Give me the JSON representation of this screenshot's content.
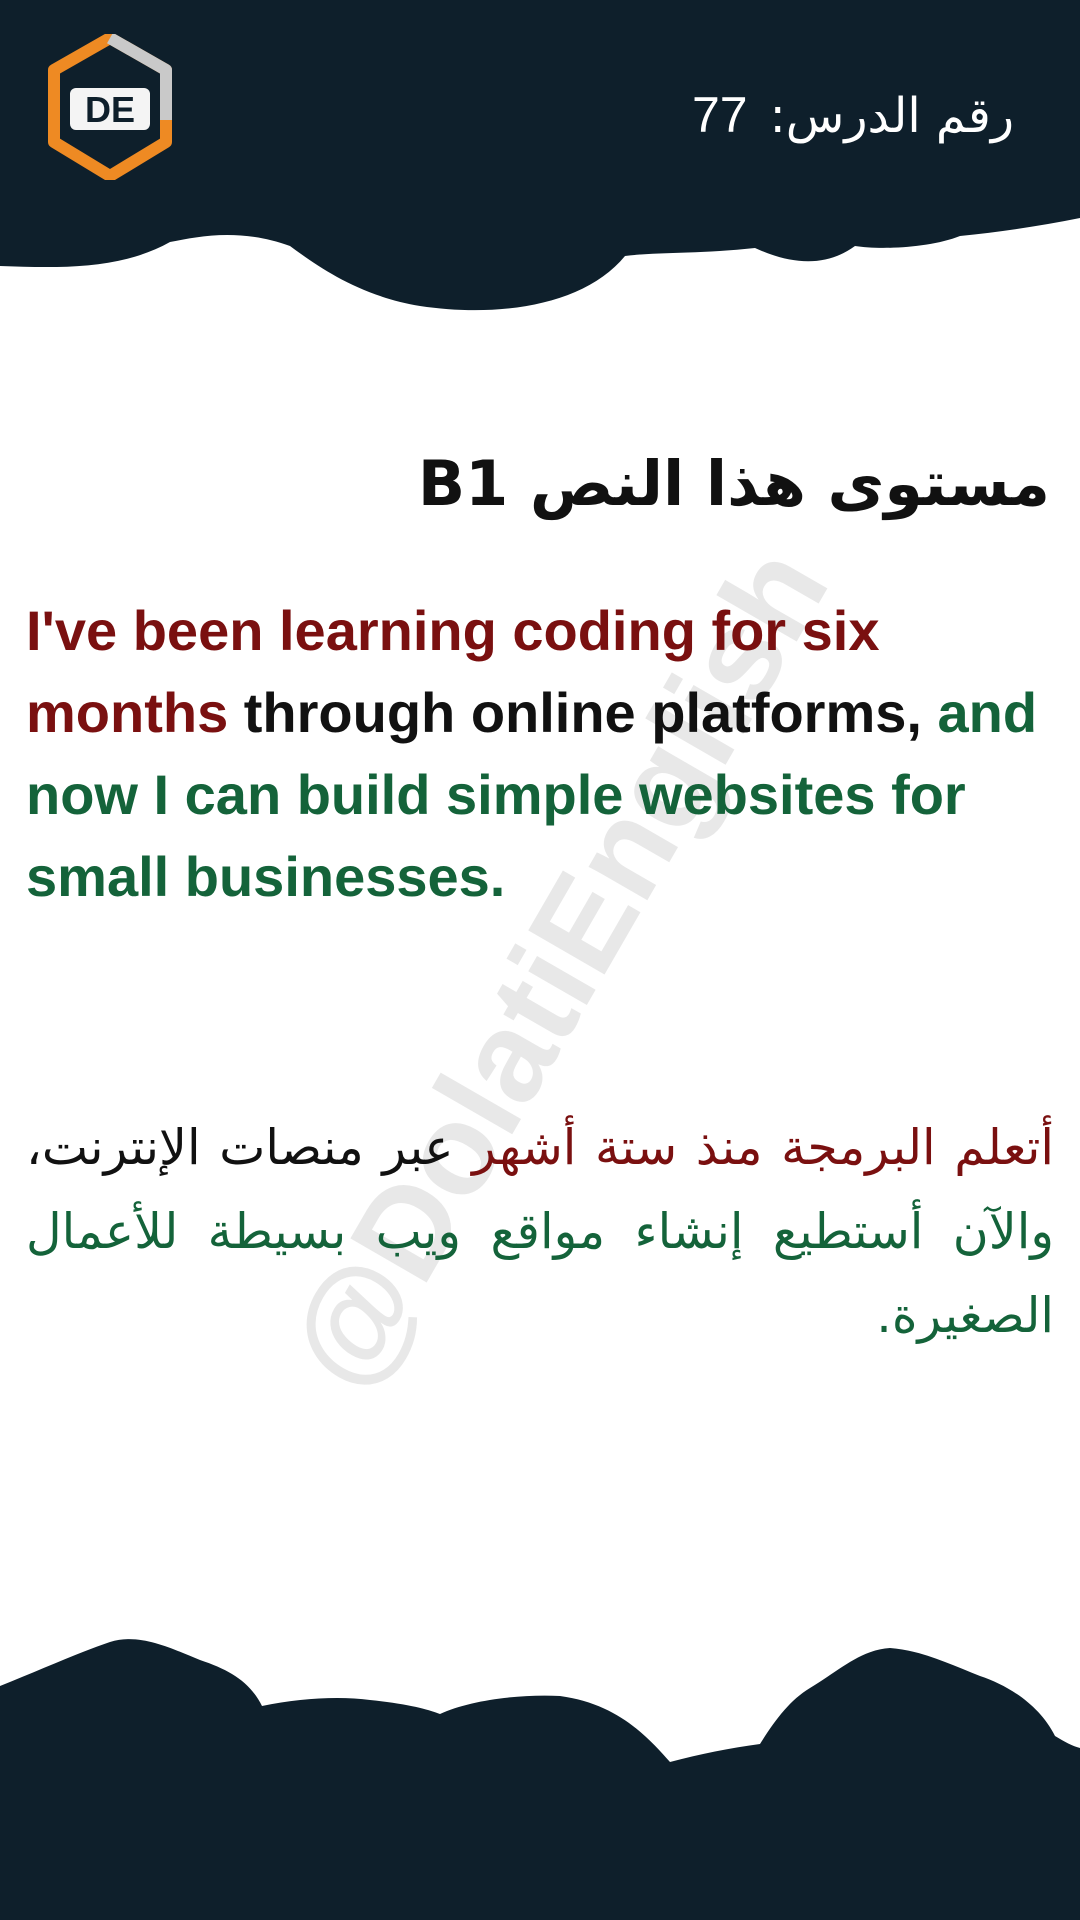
{
  "header": {
    "lesson_label": "رقم الدرس:",
    "lesson_number": "77",
    "logo_text": "DE"
  },
  "level": {
    "title": "مستوى هذا النص B1"
  },
  "english": {
    "segment_red": "I've been learning coding for six months",
    "segment_dark": " through online platforms,",
    "segment_green": " and now I can build simple websites for small businesses."
  },
  "arabic": {
    "segment_red": "أتعلم البرمجة منذ ستة أشهر",
    "segment_dark": " عبر منصات الإنترنت،",
    "segment_green": " والآن أستطيع إنشاء مواقع ويب بسيطة للأعمال الصغيرة."
  },
  "watermark": {
    "text": "@DolatiEnglish"
  },
  "colors": {
    "background": "#ffffff",
    "banner": "#0e1f2b",
    "accent_orange": "#ee8a23",
    "text_red": "#7a1010",
    "text_green": "#14633a",
    "text_dark": "#111111"
  }
}
